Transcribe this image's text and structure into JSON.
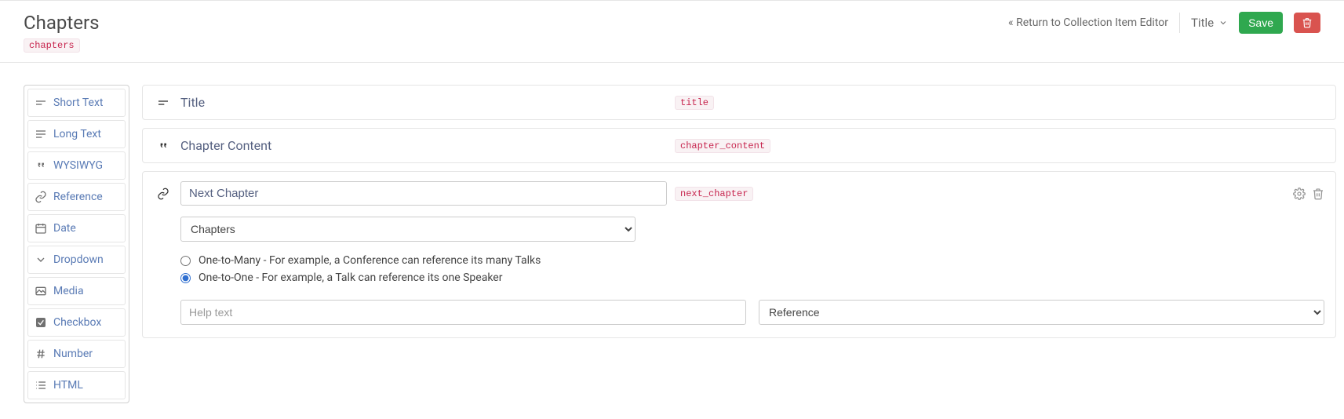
{
  "header": {
    "title": "Chapters",
    "slug": "chapters",
    "return_link": "« Return to Collection Item Editor",
    "title_dropdown": "Title",
    "save_label": "Save"
  },
  "sidebar": {
    "items": [
      {
        "label": "Short Text",
        "icon": "short-text"
      },
      {
        "label": "Long Text",
        "icon": "long-text"
      },
      {
        "label": "WYSIWYG",
        "icon": "quote"
      },
      {
        "label": "Reference",
        "icon": "link"
      },
      {
        "label": "Date",
        "icon": "calendar"
      },
      {
        "label": "Dropdown",
        "icon": "chevron-down"
      },
      {
        "label": "Media",
        "icon": "image"
      },
      {
        "label": "Checkbox",
        "icon": "checkbox"
      },
      {
        "label": "Number",
        "icon": "hash"
      },
      {
        "label": "HTML",
        "icon": "list"
      }
    ]
  },
  "fields": [
    {
      "label": "Title",
      "slug": "title",
      "icon": "short-text"
    },
    {
      "label": "Chapter Content",
      "slug": "chapter_content",
      "icon": "quote"
    }
  ],
  "active_field": {
    "name_value": "Next Chapter",
    "slug": "next_chapter",
    "icon": "link",
    "collection_select": "Chapters",
    "radio_many": "One-to-Many - For example, a Conference can reference its many Talks",
    "radio_one": "One-to-One - For example, a Talk can reference its one Speaker",
    "help_placeholder": "Help text",
    "type_select": "Reference"
  }
}
